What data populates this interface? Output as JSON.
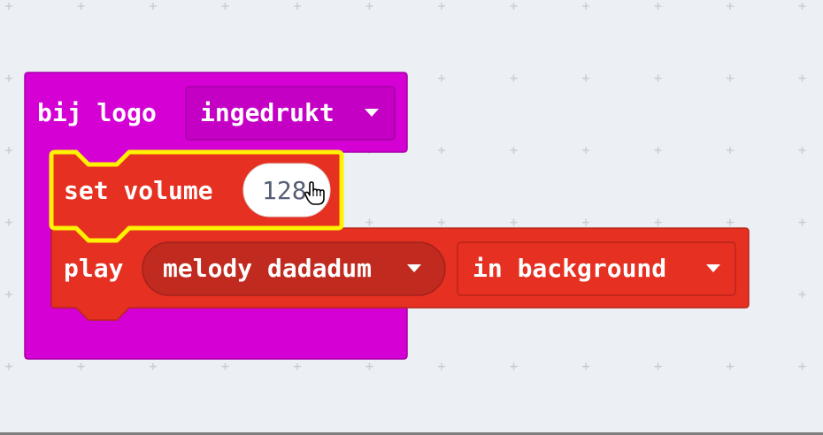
{
  "event_block": {
    "prefix": "bij logo",
    "dropdown_value": "ingedrukt",
    "color": "#d400d4"
  },
  "volume_block": {
    "label": "set volume",
    "value": "128",
    "color": "#e63022",
    "highlight_color": "#fff200"
  },
  "play_block": {
    "label": "play",
    "melody_value": "melody dadadum",
    "mode_value": "in background",
    "color": "#e63022",
    "dropdown_color": "#c02a1f"
  },
  "icons": {
    "dropdown": "chevron-down-icon",
    "cursor": "hand-pointer-icon"
  }
}
